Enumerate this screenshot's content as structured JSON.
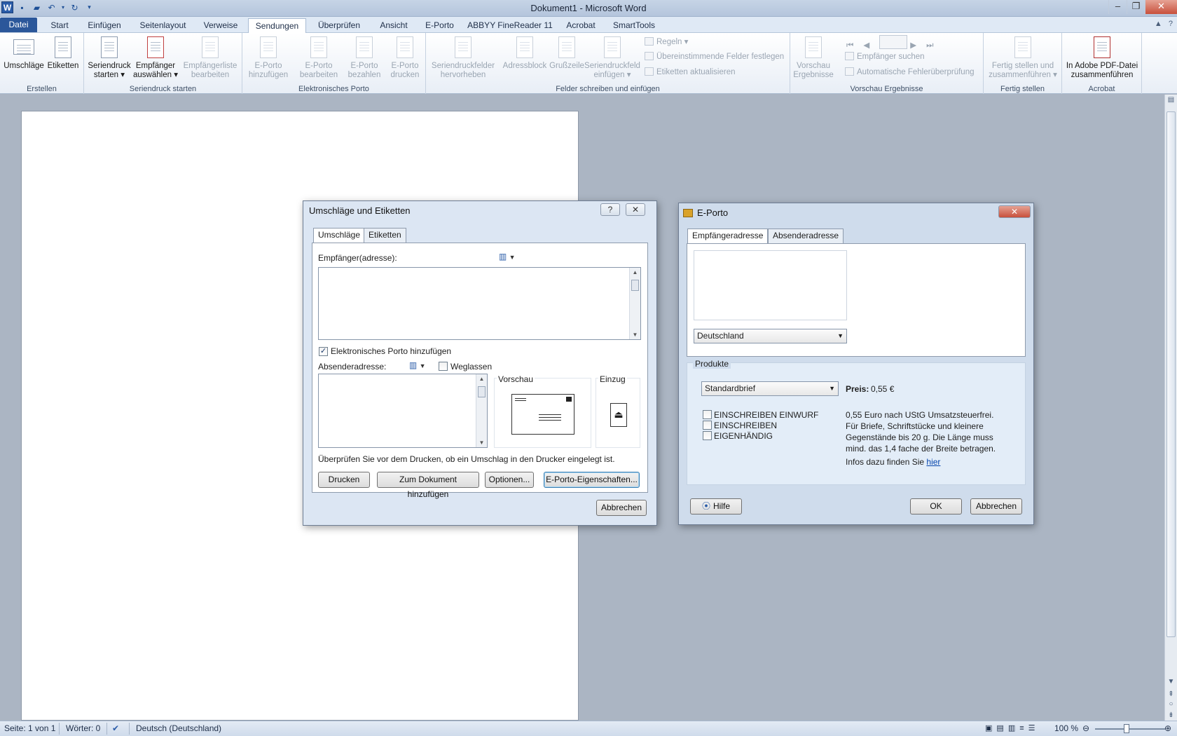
{
  "window": {
    "title": "Dokument1  -  Microsoft Word",
    "qat": {
      "app_icon": "W"
    }
  },
  "tabs": [
    "Datei",
    "Start",
    "Einfügen",
    "Seitenlayout",
    "Verweise",
    "Sendungen",
    "Überprüfen",
    "Ansicht",
    "E-Porto",
    "ABBYY FineReader 11",
    "Acrobat",
    "SmartTools"
  ],
  "active_tab": "Sendungen",
  "ribbon": {
    "groups": {
      "erstellen": "Erstellen",
      "seriendruck": "Seriendruck starten",
      "eporto": "Elektronisches Porto",
      "felder": "Felder schreiben und einfügen",
      "vorschau": "Vorschau Ergebnisse",
      "fertig": "Fertig stellen",
      "acrobat": "Acrobat"
    },
    "buttons": {
      "umschlaege": "Umschläge",
      "etiketten": "Etiketten",
      "seriendruck_starten_1": "Seriendruck",
      "seriendruck_starten_2": "starten",
      "empfaenger_auswaehlen_1": "Empfänger",
      "empfaenger_auswaehlen_2": "auswählen",
      "empfaengerliste_1": "Empfängerliste",
      "empfaengerliste_2": "bearbeiten",
      "eporto_hinzufuegen_1": "E-Porto",
      "eporto_hinzufuegen_2": "hinzufügen",
      "eporto_bearbeiten_1": "E-Porto",
      "eporto_bearbeiten_2": "bearbeiten",
      "eporto_bezahlen_1": "E-Porto",
      "eporto_bezahlen_2": "bezahlen",
      "eporto_drucken_1": "E-Porto",
      "eporto_drucken_2": "drucken",
      "seriendruckfelder_1": "Seriendruckfelder",
      "seriendruckfelder_2": "hervorheben",
      "adressblock": "Adressblock",
      "grusszeile": "Grußzeile",
      "seriendruckfeld_1": "Seriendruckfeld",
      "seriendruckfeld_2": "einfügen",
      "regeln": "Regeln",
      "felder_festlegen": "Übereinstimmende Felder festlegen",
      "etiketten_aktualisieren": "Etiketten aktualisieren",
      "vorschau_1": "Vorschau",
      "vorschau_2": "Ergebnisse",
      "empfaenger_suchen": "Empfänger suchen",
      "fehlerpruefung": "Automatische Fehlerüberprüfung",
      "fertig_1": "Fertig stellen und",
      "fertig_2": "zusammenführen",
      "pdf_1": "In Adobe PDF-Datei",
      "pdf_2": "zusammenführen"
    }
  },
  "status": {
    "seite": "Seite: 1 von 1",
    "woerter": "Wörter: 0",
    "sprache": "Deutsch (Deutschland)",
    "zoom": "100 %"
  },
  "dialog_umschlaege": {
    "title": "Umschläge und Etiketten",
    "help_btn": "?",
    "close_btn": "✕",
    "tabs": [
      "Umschläge",
      "Etiketten"
    ],
    "empfaenger_label": "Empfänger(adresse):",
    "empfaenger_value": "",
    "checkbox_eporto": "Elektronisches Porto hinzufügen",
    "checkbox_eporto_checked": true,
    "absender_label": "Absenderadresse:",
    "weglassen_label": "Weglassen",
    "absender_value": "",
    "vorschau_label": "Vorschau",
    "einzug_label": "Einzug",
    "hinweis": "Überprüfen Sie vor dem Drucken, ob ein Umschlag in den Drucker eingelegt ist.",
    "buttons": {
      "drucken": "Drucken",
      "zum_dokument": "Zum Dokument hinzufügen",
      "optionen": "Optionen...",
      "eporto_eigenschaften": "E-Porto-Eigenschaften...",
      "abbrechen": "Abbrechen"
    }
  },
  "dialog_eporto": {
    "title": "E-Porto",
    "close_btn": "✕",
    "tabs": [
      "Empfängeradresse",
      "Absenderadresse"
    ],
    "land": "Deutschland",
    "produkte_label": "Produkte",
    "produkt": "Standardbrief",
    "preis_label": "Preis:",
    "preis_value": "0,55 €",
    "options": [
      "EINSCHREIBEN EINWURF",
      "EINSCHREIBEN",
      "EIGENHÄNDIG"
    ],
    "beschreibung": "0,55 Euro nach UStG Umsatzsteuerfrei. Für Briefe, Schriftstücke und kleinere Gegenstände bis 20 g. Die Länge muss mind. das 1,4 fache der Breite betragen.",
    "infos_text": "Infos dazu finden Sie ",
    "infos_link": "hier",
    "buttons": {
      "hilfe": "Hilfe",
      "ok": "OK",
      "abbrechen": "Abbrechen"
    }
  }
}
